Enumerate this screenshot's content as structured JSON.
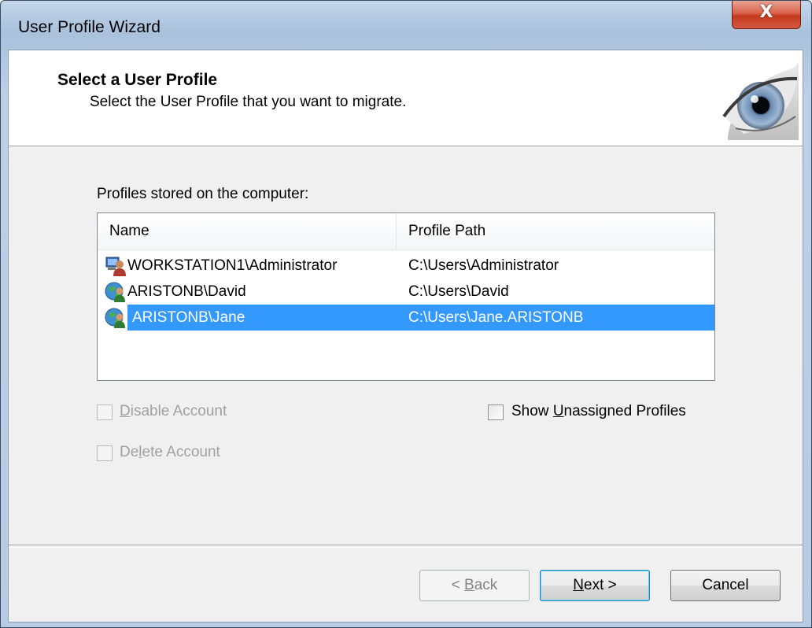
{
  "window": {
    "title": "User Profile Wizard",
    "close_glyph": "X"
  },
  "header": {
    "title": "Select a User Profile",
    "subtitle": "Select the User Profile that you want to migrate.",
    "image_icon": "eye-icon"
  },
  "profiles": {
    "label": "Profiles stored on the computer:",
    "columns": [
      "Name",
      "Profile Path"
    ],
    "rows": [
      {
        "name": "WORKSTATION1\\Administrator",
        "path": "C:\\Users\\Administrator",
        "icon": "local-user-icon",
        "selected": false
      },
      {
        "name": "ARISTONB\\David",
        "path": "C:\\Users\\David",
        "icon": "domain-user-icon",
        "selected": false
      },
      {
        "name": "ARISTONB\\Jane",
        "path": "C:\\Users\\Jane.ARISTONB",
        "icon": "domain-user-icon",
        "selected": true
      }
    ]
  },
  "options": {
    "disable_account": {
      "label_pre": "",
      "label_key": "D",
      "label_post": "isable Account",
      "checked": false,
      "enabled": false
    },
    "delete_account": {
      "label_pre": "De",
      "label_key": "l",
      "label_post": "ete Account",
      "checked": false,
      "enabled": false
    },
    "show_unassigned": {
      "label_pre": "Show ",
      "label_key": "U",
      "label_post": "nassigned Profiles",
      "checked": false,
      "enabled": true
    }
  },
  "buttons": {
    "back": {
      "pre": "< ",
      "key": "B",
      "post": "ack",
      "enabled": false
    },
    "next": {
      "pre": "",
      "key": "N",
      "post": "ext >",
      "enabled": true
    },
    "cancel": {
      "label": "Cancel",
      "enabled": true
    }
  },
  "colors": {
    "selection": "#3399ff",
    "close_button": "#c5391e"
  }
}
